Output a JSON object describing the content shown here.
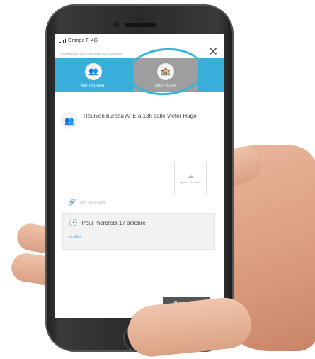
{
  "status_bar": {
    "carrier": "Orange F",
    "network": "4G"
  },
  "hint_text": "Je partage une info avec les parents",
  "tabs": [
    {
      "label": "Mon bureau"
    },
    {
      "label": "Mon école"
    }
  ],
  "message": {
    "text": "Réunion bureau APE à 13h salle Victor Hugo"
  },
  "attachment": {
    "label": "Ajouter un fichier"
  },
  "link": {
    "placeholder": "Lien ou url utile"
  },
  "date": {
    "label": "Pour mercredi 17 octobre",
    "modify": "Modifier"
  },
  "save_label": "Enregistrer",
  "colors": {
    "accent": "#3aaedb",
    "selected_tab": "#9e9e9e",
    "highlight": "#35b6d8"
  }
}
